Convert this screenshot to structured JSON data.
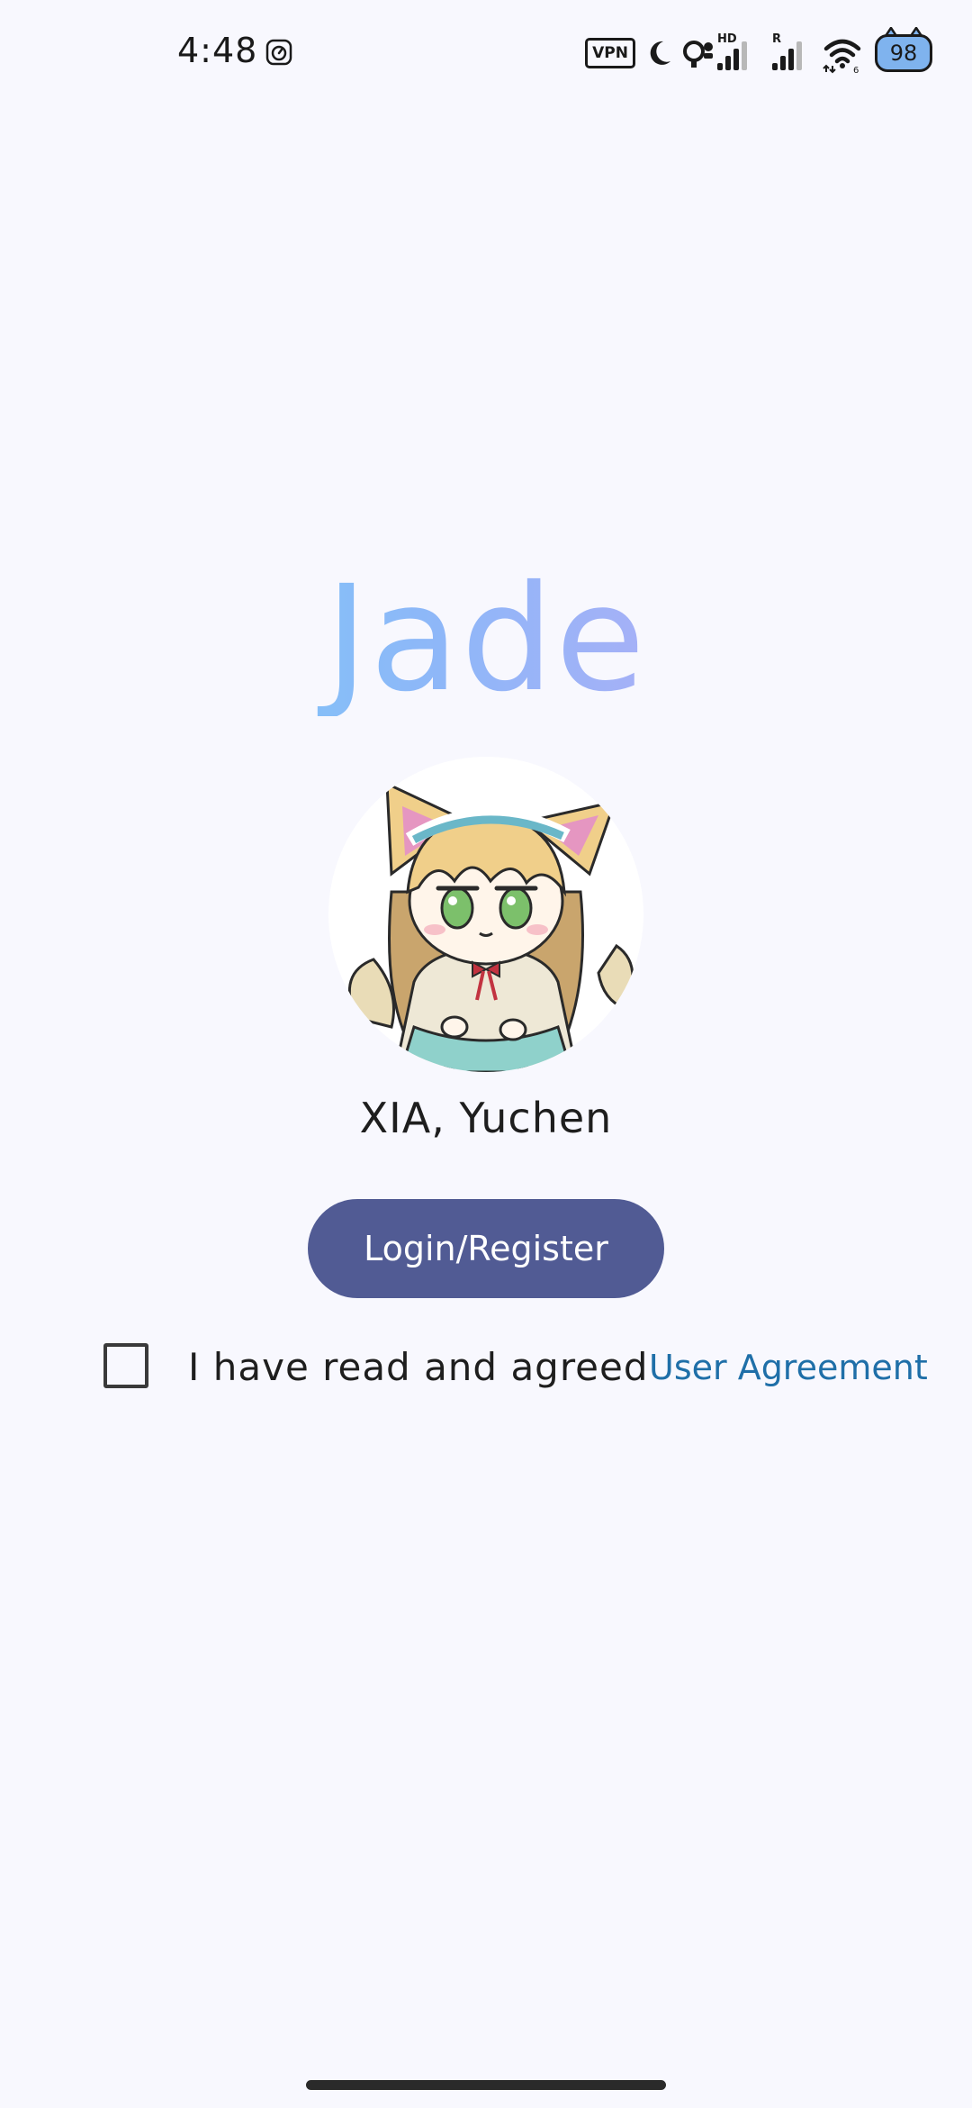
{
  "status_bar": {
    "time": "4:48",
    "vpn_label": "VPN",
    "battery_level": "98",
    "icons": [
      "alarm-icon",
      "moon-icon",
      "hotspot-icon",
      "hd-signal-icon",
      "r-signal-icon",
      "wifi-icon",
      "battery-icon"
    ]
  },
  "app": {
    "title": "Jade",
    "title_gradient": [
      "#72d2f7",
      "#8eb7f8",
      "#c9a6f5"
    ]
  },
  "profile": {
    "name": "XIA, Yuchen",
    "avatar": "anime-fox-girl-avatar"
  },
  "actions": {
    "login_label": "Login/Register",
    "login_color": "#515b94"
  },
  "agreement": {
    "checked": false,
    "text": "I have read and agreed",
    "link_label": "User Agreement",
    "link_color": "#1f6fa8"
  }
}
